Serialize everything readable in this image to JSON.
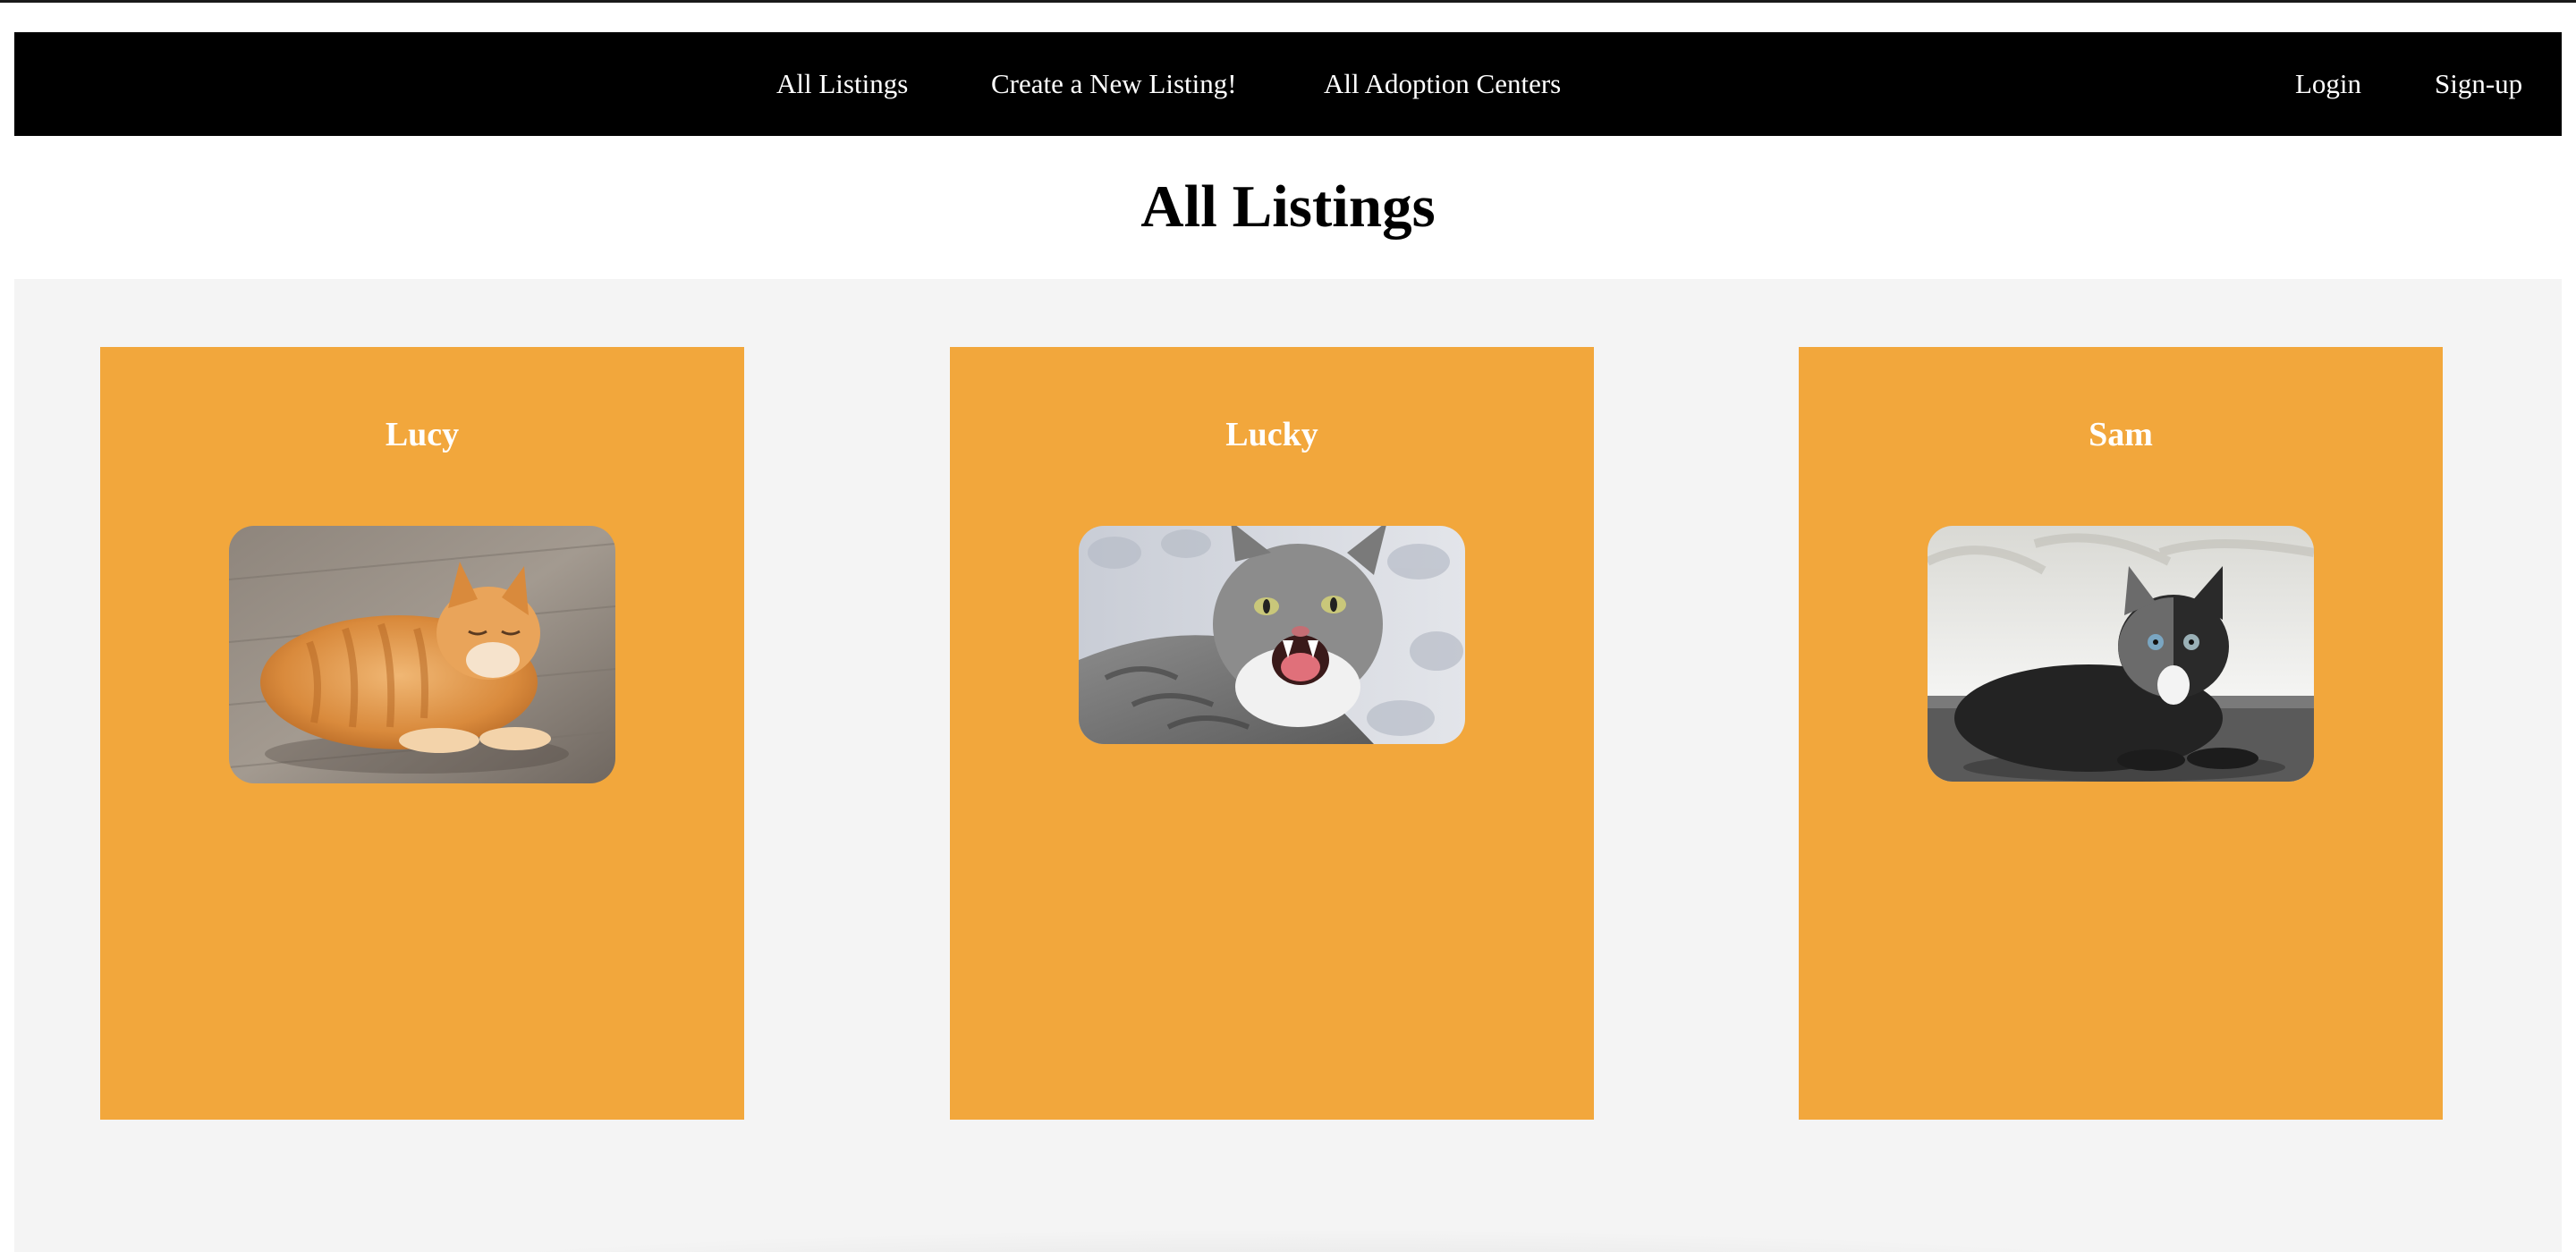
{
  "nav": {
    "links": [
      "All Listings",
      "Create a New Listing!",
      "All Adoption Centers"
    ],
    "auth": [
      "Login",
      "Sign-up"
    ]
  },
  "page": {
    "title": "All Listings"
  },
  "listings": [
    {
      "name": "Lucy",
      "photo": "orange-tabby-cat-photo"
    },
    {
      "name": "Lucky",
      "photo": "hissing-grey-tabby-cat-photo"
    },
    {
      "name": "Sam",
      "photo": "black-cat-photo"
    }
  ],
  "colors": {
    "navbar": "#000000",
    "card": "#f2a73c",
    "listings_background": "#f4f4f4",
    "text_on_dark": "#ffffff"
  }
}
